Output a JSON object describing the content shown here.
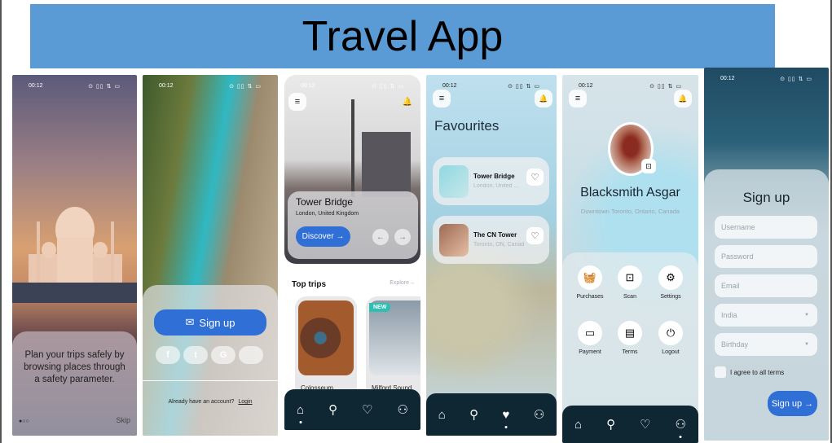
{
  "banner": {
    "title": "Travel App"
  },
  "status": {
    "time": "00:12",
    "icons": "⊙ ▯▯ ⇅ ▭"
  },
  "onboarding": {
    "text": "Plan your trips safely by browsing places through a safety parameter.",
    "skip": "Skip",
    "dots": "●○○"
  },
  "welcome": {
    "signup": "Sign up",
    "account_q": "Already have an account?",
    "login": "Login",
    "social": [
      "f",
      "t",
      "G",
      ""
    ]
  },
  "home": {
    "place": "Tower Bridge",
    "location": "London, United Kingdom",
    "discover": "Discover →",
    "top_trips": "Top trips",
    "explore": "Explore→",
    "trip1": "Colosseum",
    "trip2": "Milford Sound",
    "new_badge": "NEW"
  },
  "favourites": {
    "title": "Favourites",
    "items": [
      {
        "name": "Tower Bridge",
        "loc": "London, United ..."
      },
      {
        "name": "The CN Tower",
        "loc": "Toronto, ON, Canada"
      }
    ]
  },
  "profile": {
    "name": "Blacksmith Asgar",
    "loc": "Downtown Toronto, Ontario, Canada",
    "menu": [
      "Purchases",
      "Scan",
      "Settings",
      "Payment",
      "Terms",
      "Logout"
    ]
  },
  "signup_form": {
    "title": "Sign up",
    "username": "Username",
    "password": "Password",
    "email": "Email",
    "country": "India",
    "birthday": "Birthday",
    "agree": "I agree to all terms",
    "button": "Sign up →"
  },
  "nav_icons": [
    "home-icon",
    "search-icon",
    "heart-icon",
    "profile-icon"
  ]
}
